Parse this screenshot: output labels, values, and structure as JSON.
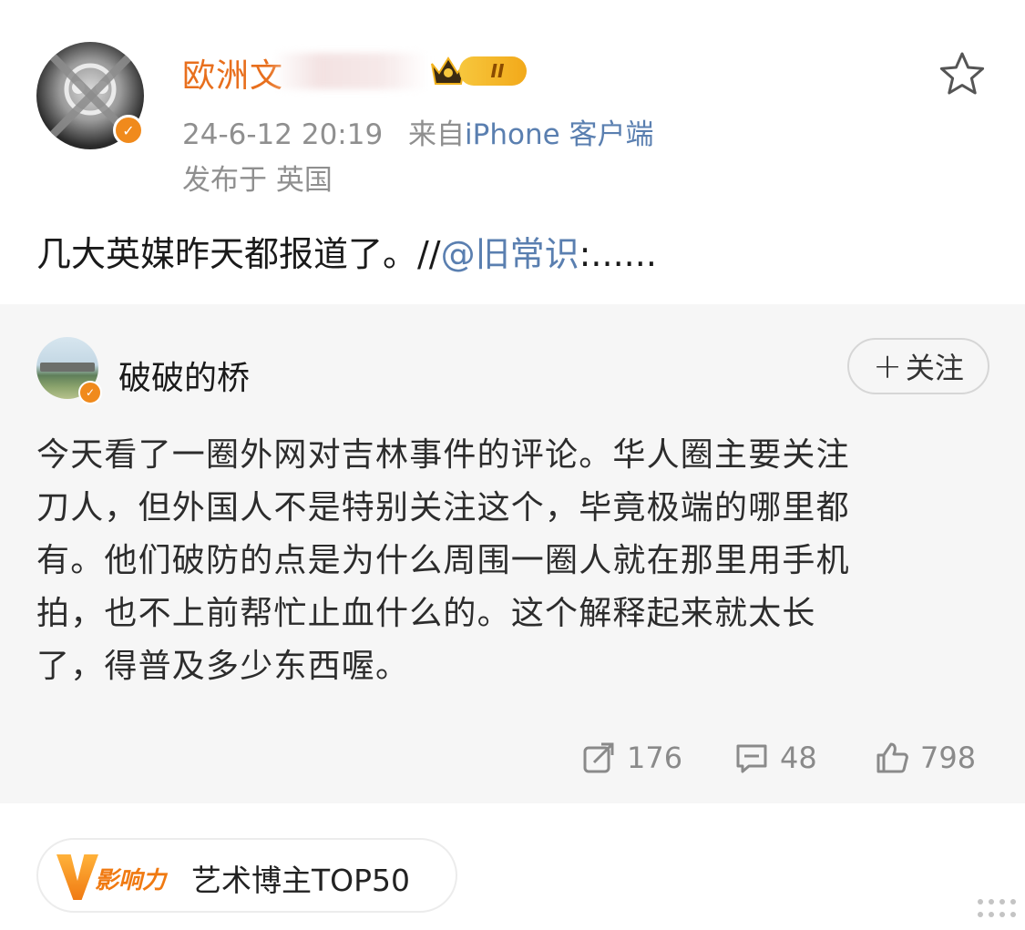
{
  "post": {
    "username": "欧洲文",
    "rank_badge": "II",
    "timestamp": "24-6-12 20:19",
    "source_prefix": "来自",
    "source": "iPhone 客户端",
    "location": "发布于 英国",
    "text_main": "几大英媒昨天都报道了。//",
    "mention": "@旧常识",
    "text_tail": ":......",
    "icons": {
      "avatar": "crossed-out-avatar",
      "favorite": "star-icon",
      "verified": "verified-badge"
    }
  },
  "retweet": {
    "author": "破破的桥",
    "follow_plus": "+",
    "follow_label": "关注",
    "body_lines": [
      "今天看了一圈外网对吉林事件的评论。华人圈主要关注",
      "刀人，但外国人不是特别关注这个，毕竟极端的哪里都",
      "有。他们破防的点是为什么周围一圈人就在那里用手机",
      "拍，也不上前帮忙止血什么的。这个解释起来就太长",
      "了，得普及多少东西喔。"
    ],
    "stats": {
      "reposts": "176",
      "comments": "48",
      "likes": "798"
    }
  },
  "influence": {
    "badge_text": "影响力",
    "label": "艺术博主TOP50"
  },
  "colors": {
    "username": "#e86f1d",
    "link": "#5a7fb0",
    "meta": "#8f8f8f",
    "retweet_bg": "#f6f6f6",
    "accent_orange": "#f07a12"
  }
}
